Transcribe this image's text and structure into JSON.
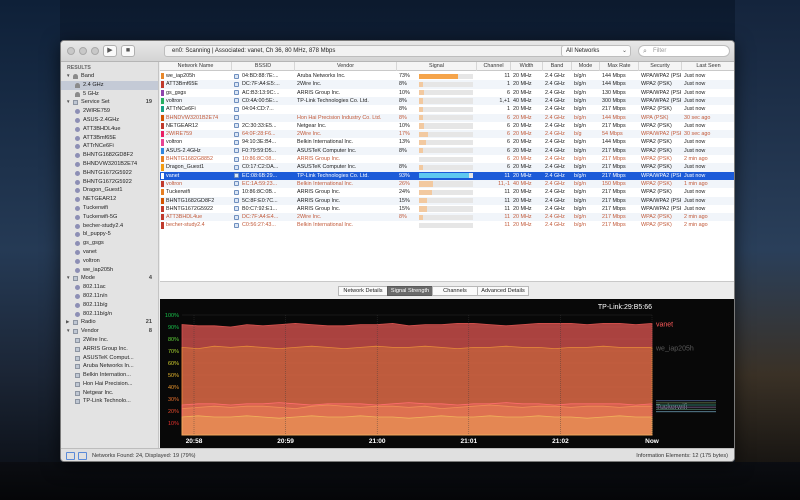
{
  "toolbar": {
    "status_text": "en0: Scanning  |  Associated: vanet, Ch 36, 80 MHz, 878 Mbps",
    "filter_value": "All Networks",
    "search_placeholder": "Filter"
  },
  "sidebar": {
    "results_label": "RESULTS",
    "groups": [
      {
        "label": "Band",
        "count": "",
        "items": [
          "2.4 GHz",
          "5 GHz"
        ]
      },
      {
        "label": "Service Set",
        "count": "19",
        "items": [
          "2WIRE759",
          "ASUS-2.4GHz",
          "ATT3BHDL4ue",
          "ATT3Bmf65E",
          "ATTrNCe6Fi",
          "BHNTG1682GD8F2",
          "BHNDVW3201B2E74",
          "BHNTG1672G5922",
          "BHNTG1672G5922",
          "Dragon_Guest1",
          "NETGEAR12",
          "Tuckerwifi",
          "Tuckerwifi-5G",
          "becher-study2.4",
          "bl_puppy-5",
          "gs_gsgs",
          "vanet",
          "voltron",
          "we_iap205h"
        ]
      },
      {
        "label": "Mode",
        "count": "4",
        "items": [
          "802.11ac",
          "802.11n/n",
          "802.11b/g",
          "802.11b/g/n"
        ]
      },
      {
        "label": "Radio",
        "count": "21",
        "items": []
      },
      {
        "label": "Vendor",
        "count": "8",
        "items": [
          "2Wire Inc.",
          "ARRIS Group Inc.",
          "ASUSTeK Comput...",
          "Aruba Networks In...",
          "Belkin Internation...",
          "Hon Hai Precision...",
          "Netgear Inc.",
          "TP-Link Technolo..."
        ]
      }
    ]
  },
  "table": {
    "columns": [
      "Network Name",
      "BSSID",
      "Vendor",
      "Signal",
      "Channel",
      "Width",
      "Band",
      "Mode",
      "Max Rate",
      "Security",
      "Last Seen"
    ],
    "rows": [
      {
        "name": "we_iap205h",
        "bssid": "04:BD:88:7E:...",
        "vendor": "Aruba Networks Inc.",
        "sig": "73%",
        "sigv": 73,
        "ch": "11",
        "width": "20 MHz",
        "band": "2.4 GHz",
        "mode": "b/g/n",
        "rate": "144 Mbps",
        "sec": "WPA/WPA2 (PSK)",
        "seen": "Just now",
        "color": "#e8872a",
        "state": "normal"
      },
      {
        "name": "ATT3Bmf65E",
        "bssid": "DC:7F:A4:E5:...",
        "vendor": "2Wire Inc.",
        "sig": "8%",
        "sigv": 8,
        "ch": "1",
        "width": "20 MHz",
        "band": "2.4 GHz",
        "mode": "b/g/n",
        "rate": "144 Mbps",
        "sec": "WPA2 (PSK)",
        "seen": "Just now",
        "color": "#c0392b",
        "state": "normal"
      },
      {
        "name": "gs_gsgs",
        "bssid": "AC:B3:13:9C:...",
        "vendor": "ARRIS Group Inc.",
        "sig": "10%",
        "sigv": 10,
        "ch": "6",
        "width": "20 MHz",
        "band": "2.4 GHz",
        "mode": "b/g/n",
        "rate": "130 Mbps",
        "sec": "WPA/WPA2 (PSK)",
        "seen": "Just now",
        "color": "#8e44ad",
        "state": "normal"
      },
      {
        "name": "voltron",
        "bssid": "C0:4A:00:5E:...",
        "vendor": "TP-Link Technologies Co. Ltd.",
        "sig": "8%",
        "sigv": 8,
        "ch": "1,+1",
        "width": "40 MHz",
        "band": "2.4 GHz",
        "mode": "b/g/n",
        "rate": "300 Mbps",
        "sec": "WPA/WPA2 (PSK)",
        "seen": "Just now",
        "color": "#27ae60",
        "state": "normal"
      },
      {
        "name": "ATTrNCe6Fi",
        "bssid": "04:04:CD:7...",
        "vendor": "",
        "sig": "8%",
        "sigv": 8,
        "ch": "1",
        "width": "20 MHz",
        "band": "2.4 GHz",
        "mode": "b/g/n",
        "rate": "217 Mbps",
        "sec": "WPA2 (PSK)",
        "seen": "Just now",
        "color": "#16a085",
        "state": "normal"
      },
      {
        "name": "BHNDVW3201B2E74",
        "bssid": "",
        "vendor": "Hon Hai Precision Industry Co. Ltd.",
        "sig": "8%",
        "sigv": 8,
        "ch": "6",
        "width": "20 MHz",
        "band": "2.4 GHz",
        "mode": "b/g/n",
        "rate": "144 Mbps",
        "sec": "WPA (PSK)",
        "seen": "30 sec ago",
        "color": "#d35400",
        "state": "weak"
      },
      {
        "name": "NETGEAR12",
        "bssid": "2C:30:33:E5...",
        "vendor": "Netgear Inc.",
        "sig": "10%",
        "sigv": 10,
        "ch": "6",
        "width": "20 MHz",
        "band": "2.4 GHz",
        "mode": "b/g/n",
        "rate": "217 Mbps",
        "sec": "WPA2 (PSK)",
        "seen": "Just now",
        "color": "#c0392b",
        "state": "normal"
      },
      {
        "name": "2WIRE759",
        "bssid": "64:0F:28:F6...",
        "vendor": "2Wire Inc.",
        "sig": "17%",
        "sigv": 17,
        "ch": "6",
        "width": "20 MHz",
        "band": "2.4 GHz",
        "mode": "b/g",
        "rate": "54 Mbps",
        "sec": "WPA/WPA2 (PSK)",
        "seen": "30 sec ago",
        "color": "#e91e63",
        "state": "weak"
      },
      {
        "name": "voltron",
        "bssid": "94:10:3E:B4...",
        "vendor": "Belkin International Inc.",
        "sig": "13%",
        "sigv": 13,
        "ch": "6",
        "width": "20 MHz",
        "band": "2.4 GHz",
        "mode": "b/g/n",
        "rate": "144 Mbps",
        "sec": "WPA2 (PSK)",
        "seen": "Just now",
        "color": "#e84393",
        "state": "normal"
      },
      {
        "name": "ASUS-2.4GHz",
        "bssid": "F0:79:59:D5...",
        "vendor": "ASUSTeK Computer Inc.",
        "sig": "8%",
        "sigv": 8,
        "ch": "6",
        "width": "20 MHz",
        "band": "2.4 GHz",
        "mode": "b/g/n",
        "rate": "217 Mbps",
        "sec": "WPA2 (PSK)",
        "seen": "Just now",
        "color": "#2e86de",
        "state": "normal"
      },
      {
        "name": "BHNTG1682G8852",
        "bssid": "10:86:8C:08...",
        "vendor": "ARRIS Group Inc.",
        "sig": "",
        "sigv": 0,
        "ch": "6",
        "width": "20 MHz",
        "band": "2.4 GHz",
        "mode": "b/g/n",
        "rate": "217 Mbps",
        "sec": "WPA2 (PSK)",
        "seen": "2 min ago",
        "color": "#e67e22",
        "state": "weak"
      },
      {
        "name": "Dragon_Guest1",
        "bssid": "C0:17:C2:DA...",
        "vendor": "ASUSTeK Computer Inc.",
        "sig": "8%",
        "sigv": 8,
        "ch": "6",
        "width": "20 MHz",
        "band": "2.4 GHz",
        "mode": "b/g/n",
        "rate": "217 Mbps",
        "sec": "WPA2 (PSK)",
        "seen": "Just now",
        "color": "#f39c12",
        "state": "normal"
      },
      {
        "name": "vanet",
        "bssid": "EC:08:6B:29...",
        "vendor": "TP-Link Technologies Co. Ltd.",
        "sig": "93%",
        "sigv": 93,
        "ch": "11",
        "width": "20 MHz",
        "band": "2.4 GHz",
        "mode": "b/g/n",
        "rate": "217 Mbps",
        "sec": "WPA/WPA2 (PSK)",
        "seen": "Just now",
        "color": "#ffffff",
        "state": "sel"
      },
      {
        "name": "voltron",
        "bssid": "EC:1A:59:23...",
        "vendor": "Belkin International Inc.",
        "sig": "26%",
        "sigv": 26,
        "ch": "11,-1",
        "width": "40 MHz",
        "band": "2.4 GHz",
        "mode": "b/g/n",
        "rate": "150 Mbps",
        "sec": "WPA2 (PSK)",
        "seen": "1 min ago",
        "color": "#c0392b",
        "state": "weak"
      },
      {
        "name": "Tuckerwifi",
        "bssid": "10:86:8C:0B...",
        "vendor": "ARRIS Group Inc.",
        "sig": "24%",
        "sigv": 24,
        "ch": "11",
        "width": "20 MHz",
        "band": "2.4 GHz",
        "mode": "b/g/n",
        "rate": "217 Mbps",
        "sec": "WPA2 (PSK)",
        "seen": "Just now",
        "color": "#e67e22",
        "state": "normal"
      },
      {
        "name": "BHNTG1682GD8F2",
        "bssid": "5C:8F:E0:7C...",
        "vendor": "ARRIS Group Inc.",
        "sig": "15%",
        "sigv": 15,
        "ch": "11",
        "width": "20 MHz",
        "band": "2.4 GHz",
        "mode": "b/g/n",
        "rate": "217 Mbps",
        "sec": "WPA/WPA2 (PSK)",
        "seen": "Just now",
        "color": "#d35400",
        "state": "normal"
      },
      {
        "name": "BHNTG1672G5922",
        "bssid": "B0:C7:92:E1...",
        "vendor": "ARRIS Group Inc.",
        "sig": "15%",
        "sigv": 15,
        "ch": "11",
        "width": "20 MHz",
        "band": "2.4 GHz",
        "mode": "b/g/n",
        "rate": "217 Mbps",
        "sec": "WPA/WPA2 (PSK)",
        "seen": "Just now",
        "color": "#c0392b",
        "state": "normal"
      },
      {
        "name": "ATT3BHDL4ue",
        "bssid": "DC:7F:A4:E4...",
        "vendor": "2Wire Inc.",
        "sig": "8%",
        "sigv": 8,
        "ch": "11",
        "width": "20 MHz",
        "band": "2.4 GHz",
        "mode": "b/g/n",
        "rate": "217 Mbps",
        "sec": "WPA2 (PSK)",
        "seen": "2 min ago",
        "color": "#c0392b",
        "state": "weak"
      },
      {
        "name": "becher-study2.4",
        "bssid": "C0:56:27:43...",
        "vendor": "Belkin International Inc.",
        "sig": "",
        "sigv": 0,
        "ch": "11",
        "width": "20 MHz",
        "band": "2.4 GHz",
        "mode": "b/g/n",
        "rate": "217 Mbps",
        "sec": "WPA2 (PSK)",
        "seen": "2 min ago",
        "color": "#c0392b",
        "state": "weak"
      }
    ]
  },
  "tabs": [
    "Network Details",
    "Signal Strength",
    "Channels",
    "Advanced Details"
  ],
  "active_tab": 1,
  "chart_data": {
    "type": "area",
    "title": "TP-Link:29:B5:66",
    "ylim": [
      0,
      100
    ],
    "yticks": [
      "100%",
      "90%",
      "80%",
      "70%",
      "60%",
      "50%",
      "40%",
      "30%",
      "20%",
      "10%"
    ],
    "ytick_colors": [
      "#19c24b",
      "#19c24b",
      "#5fd23a",
      "#a8d630",
      "#d6d12e",
      "#e8b72d",
      "#e8952d",
      "#e8702d",
      "#e84a2d",
      "#e8312d"
    ],
    "xticks": [
      "20:58",
      "20:59",
      "21:00",
      "21:01",
      "21:02",
      "Now"
    ],
    "series_labels": [
      {
        "name": "vanet",
        "value": 93
      },
      {
        "name": "we_iap205h",
        "value": 73
      },
      {
        "name": "Tuckerwifi",
        "value": 24
      }
    ],
    "series": [
      {
        "name": "vanet",
        "color": "#d9534f",
        "values": [
          92,
          91,
          91,
          90,
          92,
          91,
          92,
          93,
          92,
          91,
          91,
          92,
          92,
          93,
          91,
          92,
          92,
          93,
          93,
          92,
          91,
          92,
          93,
          93,
          93,
          92,
          93,
          93,
          92,
          93
        ]
      },
      {
        "name": "we_iap205h",
        "color": "#e58a3a",
        "values": [
          73,
          72,
          74,
          73,
          74,
          73,
          72,
          73,
          74,
          73,
          72,
          73,
          74,
          73,
          73,
          74,
          73,
          72,
          73,
          73,
          74,
          73,
          73,
          72,
          73,
          73,
          74,
          73,
          73,
          73
        ]
      },
      {
        "name": "Tuckerwifi",
        "color": "#e9a14a",
        "values": [
          22,
          23,
          24,
          23,
          24,
          24,
          23,
          22,
          24,
          25,
          24,
          23,
          24,
          24,
          23,
          24,
          22,
          23,
          24,
          25,
          24,
          23,
          24,
          24,
          23,
          24,
          24,
          23,
          24,
          24
        ]
      },
      {
        "name": "voltron",
        "color": "#ff6e6e",
        "values": [
          25,
          26,
          26,
          25,
          26,
          26,
          27,
          26,
          25,
          26,
          26,
          26,
          25,
          26,
          27,
          26,
          26,
          25,
          26,
          26,
          27,
          26,
          26,
          25,
          26,
          26,
          26,
          26,
          25,
          26
        ]
      },
      {
        "name": "BHNTG1682GD8F2",
        "color": "#f0b25a",
        "values": [
          15,
          16,
          15,
          15,
          16,
          15,
          14,
          15,
          16,
          15,
          15,
          16,
          15,
          15,
          14,
          15,
          16,
          15,
          15,
          16,
          15,
          15,
          16,
          15,
          15,
          14,
          15,
          16,
          15,
          15
        ]
      }
    ]
  },
  "footer": {
    "left": "Networks Found: 24, Displayed: 19 (79%)",
    "right": "Information Elements: 12 (175 bytes)"
  }
}
